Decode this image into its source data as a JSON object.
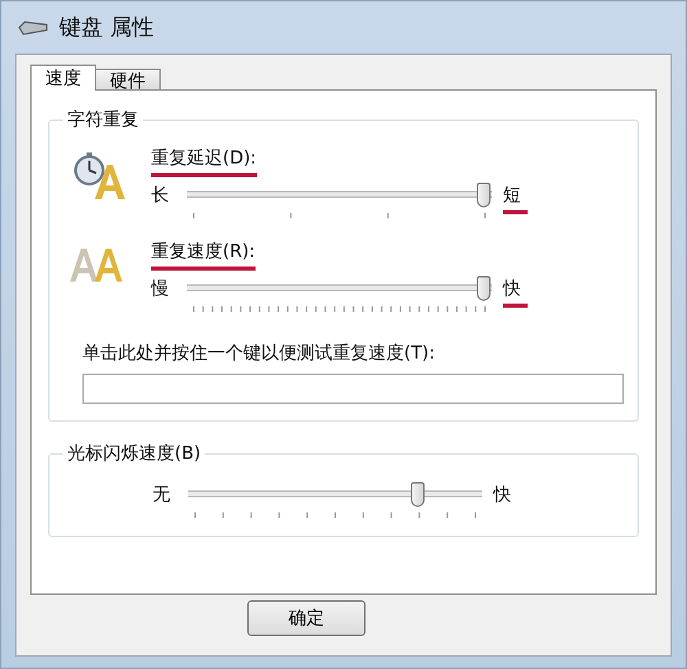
{
  "window": {
    "title": "键盘 属性"
  },
  "tabs": [
    {
      "label": "速度",
      "selected": true
    },
    {
      "label": "硬件",
      "selected": false
    }
  ],
  "character_repeat": {
    "title": "字符重复",
    "sliders": [
      {
        "kind": "delay",
        "label": "重复延迟(D):",
        "label_marked": true,
        "min_label": "长",
        "max_label": "短",
        "max_marked": true,
        "level": 1.0
      },
      {
        "kind": "rate",
        "label": "重复速度(R):",
        "label_marked": true,
        "min_label": "慢",
        "max_label": "快",
        "max_marked": true,
        "level": 1.0
      }
    ],
    "test_field": {
      "label": "单击此处并按住一个键以便测试重复速度(T):"
    }
  },
  "cursor_blink": {
    "title": "光标闪烁速度(B)",
    "min_label": "无",
    "max_label": "快",
    "level": 0.8
  },
  "buttons": [
    "确定"
  ]
}
